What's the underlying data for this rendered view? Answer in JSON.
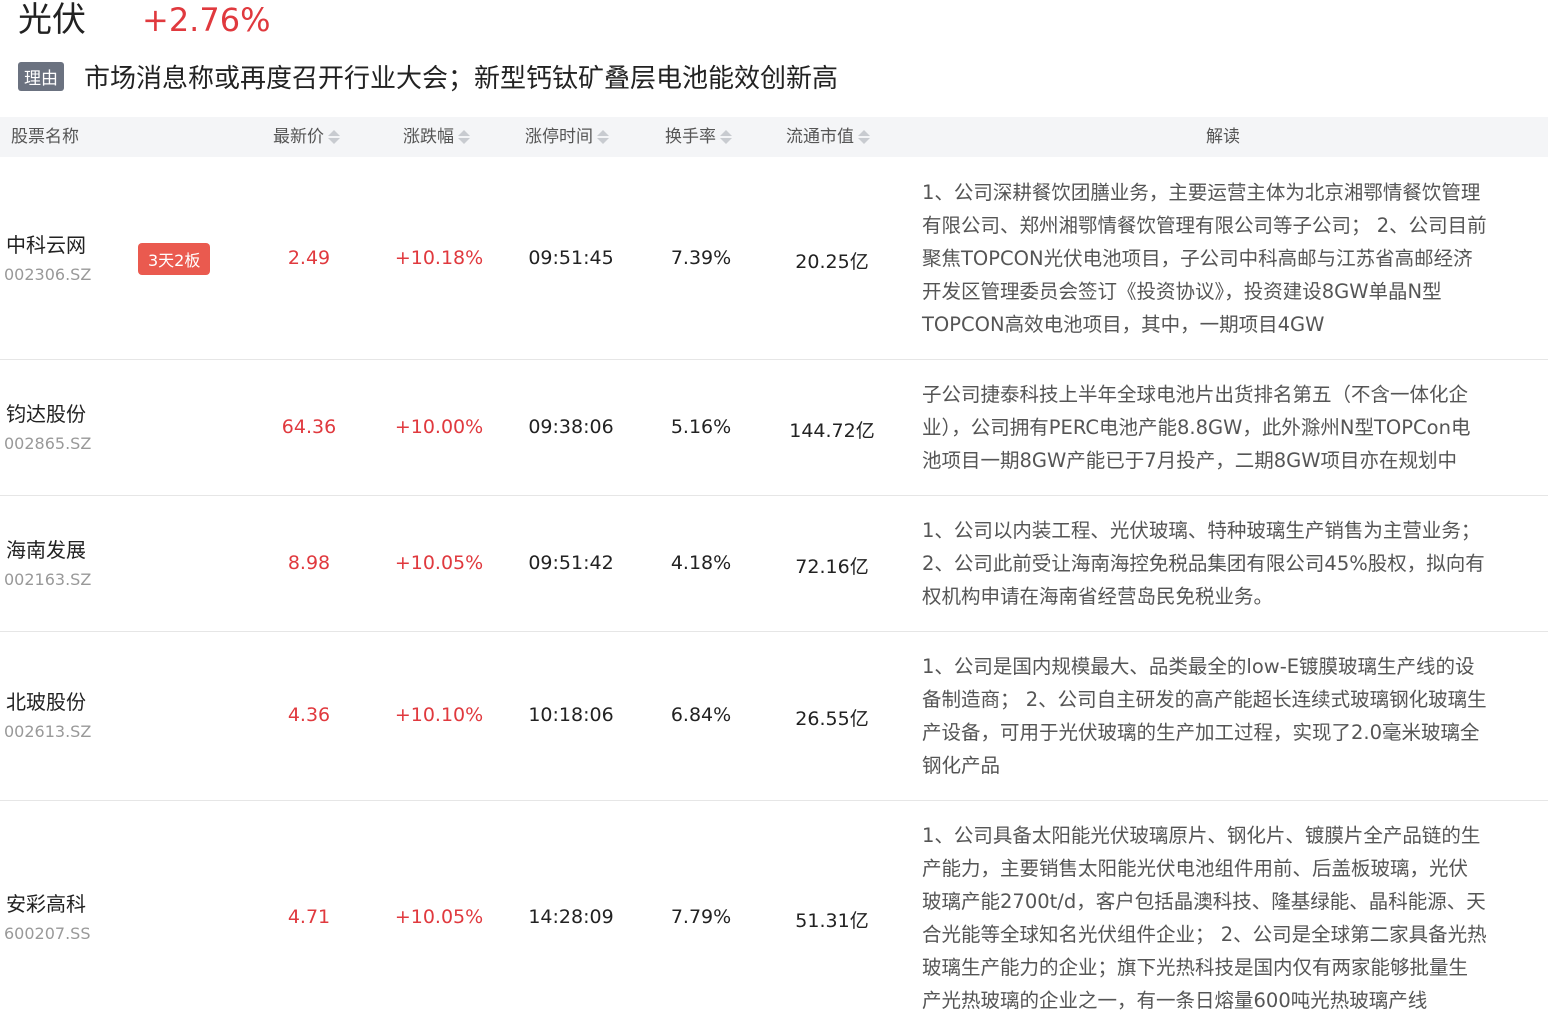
{
  "header": {
    "sector_name": "光伏",
    "sector_change": "+2.76%"
  },
  "reason": {
    "tag": "理由",
    "text": "市场消息称或再度召开行业大会；新型钙钛矿叠层电池能效创新高"
  },
  "columns": {
    "name": "股票名称",
    "price": "最新价",
    "change": "涨跌幅",
    "limit_time": "涨停时间",
    "turnover": "换手率",
    "market_cap": "流通市值",
    "interpret": "解读"
  },
  "rows": [
    {
      "name": "中科云网",
      "code": "002306.SZ",
      "badge": "3天2板",
      "price": "2.49",
      "change": "+10.18%",
      "limit_time": "09:51:45",
      "turnover": "7.39%",
      "market_cap": "20.25亿",
      "desc_lines": [
        "1、公司深耕餐饮团膳业务，主要运营主体为北京湘鄂情餐饮管理",
        "有限公司、郑州湘鄂情餐饮管理有限公司等子公司； 2、公司目前",
        "聚焦TOPCON光伏电池项目，子公司中科高邮与江苏省高邮经济",
        "开发区管理委员会签订《投资协议》，投资建设8GW单晶N型",
        "TOPCON高效电池项目，其中，一期项目4GW"
      ]
    },
    {
      "name": "钧达股份",
      "code": "002865.SZ",
      "badge": "",
      "price": "64.36",
      "change": "+10.00%",
      "limit_time": "09:38:06",
      "turnover": "5.16%",
      "market_cap": "144.72亿",
      "desc_lines": [
        "子公司捷泰科技上半年全球电池片出货排名第五（不含一体化企",
        "业），公司拥有PERC电池产能8.8GW，此外滁州N型TOPCon电",
        "池项目一期8GW产能已于7月投产，二期8GW项目亦在规划中"
      ]
    },
    {
      "name": "海南发展",
      "code": "002163.SZ",
      "badge": "",
      "price": "8.98",
      "change": "+10.05%",
      "limit_time": "09:51:42",
      "turnover": "4.18%",
      "market_cap": "72.16亿",
      "desc_lines": [
        "1、公司以内装工程、光伏玻璃、特种玻璃生产销售为主营业务；",
        "2、公司此前受让海南海控免税品集团有限公司45%股权，拟向有",
        "权机构申请在海南省经营岛民免税业务。"
      ]
    },
    {
      "name": "北玻股份",
      "code": "002613.SZ",
      "badge": "",
      "price": "4.36",
      "change": "+10.10%",
      "limit_time": "10:18:06",
      "turnover": "6.84%",
      "market_cap": "26.55亿",
      "desc_lines": [
        "1、公司是国内规模最大、品类最全的low-E镀膜玻璃生产线的设",
        "备制造商； 2、公司自主研发的高产能超长连续式玻璃钢化玻璃生",
        "产设备，可用于光伏玻璃的生产加工过程，实现了2.0毫米玻璃全",
        "钢化产品"
      ]
    },
    {
      "name": "安彩高科",
      "code": "600207.SS",
      "badge": "",
      "price": "4.71",
      "change": "+10.05%",
      "limit_time": "14:28:09",
      "turnover": "7.79%",
      "market_cap": "51.31亿",
      "desc_lines": [
        "1、公司具备太阳能光伏玻璃原片、钢化片、镀膜片全产品链的生",
        "产能力，主要销售太阳能光伏电池组件用前、后盖板玻璃，光伏",
        "玻璃产能2700t/d，客户包括晶澳科技、隆基绿能、晶科能源、天",
        "合光能等全球知名光伏组件企业； 2、公司是全球第二家具备光热",
        "玻璃生产能力的企业；旗下光热科技是国内仅有两家能够批量生",
        "产光热玻璃的企业之一，有一条日熔量600吨光热玻璃产线"
      ]
    }
  ]
}
